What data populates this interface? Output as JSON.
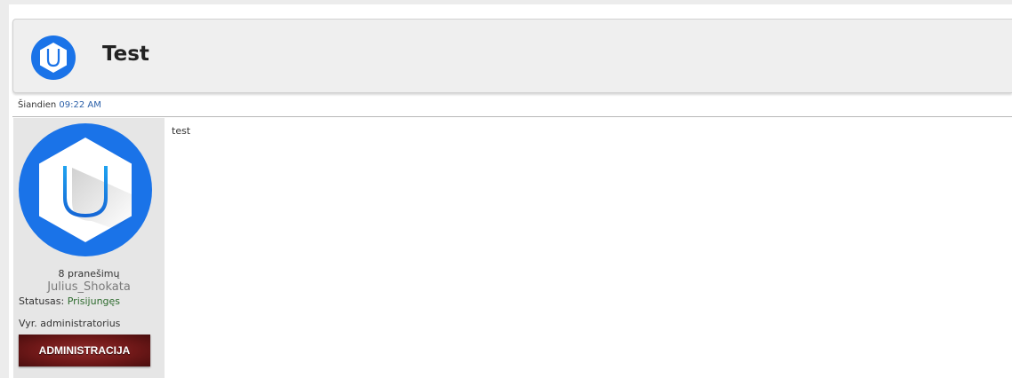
{
  "topic": {
    "title": "Test",
    "icon": "ucoz-hexagon-u-icon"
  },
  "post": {
    "date_label": "Šiandien",
    "time": "09:22 AM",
    "body": "test"
  },
  "author": {
    "avatar_icon": "ucoz-hexagon-u-icon",
    "posts_count": "8 pranešimų",
    "username": "Julius_Shokata",
    "status_label": "Statusas:",
    "status_value": "Prisijungęs",
    "rank": "Vyr. administratorius",
    "rank_badge": "ADMINISTRACIJA"
  },
  "colors": {
    "brand_blue": "#1a73e8",
    "rank_badge_red": "#7a1c1c",
    "link_blue": "#2a5fa8"
  }
}
